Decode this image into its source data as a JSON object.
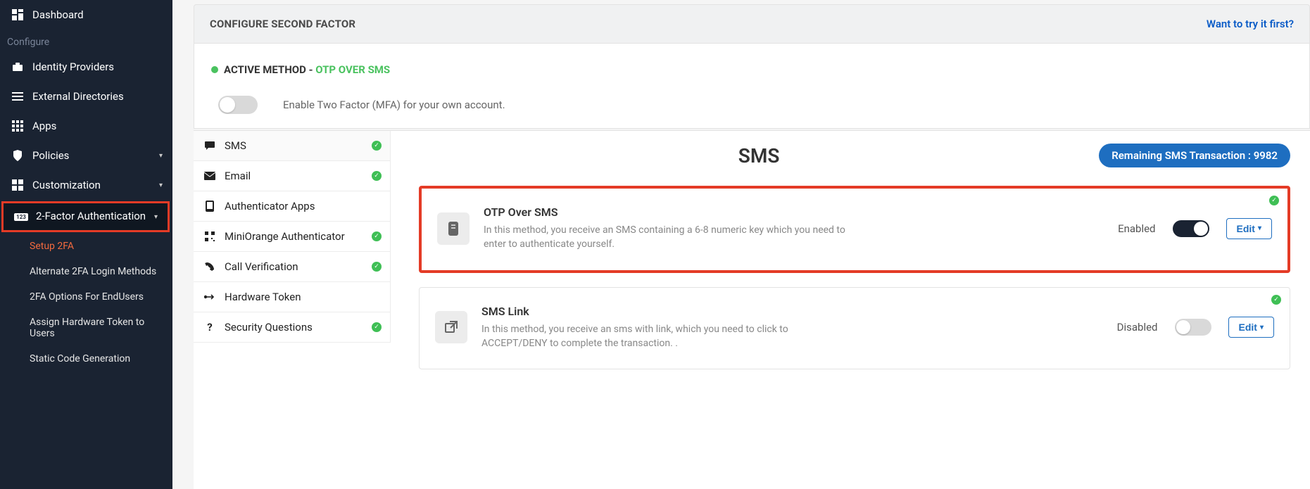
{
  "sidebar": {
    "dashboard": "Dashboard",
    "section_configure": "Configure",
    "identity_providers": "Identity Providers",
    "external_directories": "External Directories",
    "apps": "Apps",
    "policies": "Policies",
    "customization": "Customization",
    "twofa": "2-Factor Authentication",
    "sub": {
      "setup": "Setup 2FA",
      "alternate": "Alternate 2FA Login Methods",
      "endusers": "2FA Options For EndUsers",
      "assign_hw": "Assign Hardware Token to Users",
      "static_codes": "Static Code Generation"
    }
  },
  "header": {
    "title": "CONFIGURE SECOND FACTOR",
    "try_link": "Want to try it first?"
  },
  "active": {
    "label": "ACTIVE METHOD - ",
    "value": "OTP OVER SMS"
  },
  "enable_text": "Enable Two Factor (MFA) for your own account.",
  "tabs": {
    "sms": "SMS",
    "email": "Email",
    "auth_apps": "Authenticator Apps",
    "miniorange": "MiniOrange Authenticator",
    "call": "Call Verification",
    "hw": "Hardware Token",
    "security_q": "Security Questions"
  },
  "content_header": {
    "heading": "SMS",
    "badge": "Remaining SMS Transaction : 9982"
  },
  "cards": {
    "otp_sms": {
      "title": "OTP Over SMS",
      "desc": "In this method, you receive an SMS containing a 6-8 numeric key which you need to enter to authenticate yourself.",
      "status": "Enabled",
      "edit": "Edit"
    },
    "sms_link": {
      "title": "SMS Link",
      "desc": "In this method, you receive an sms with link, which you need to click to ACCEPT/DENY to complete the transaction. .",
      "status": "Disabled",
      "edit": "Edit"
    }
  }
}
